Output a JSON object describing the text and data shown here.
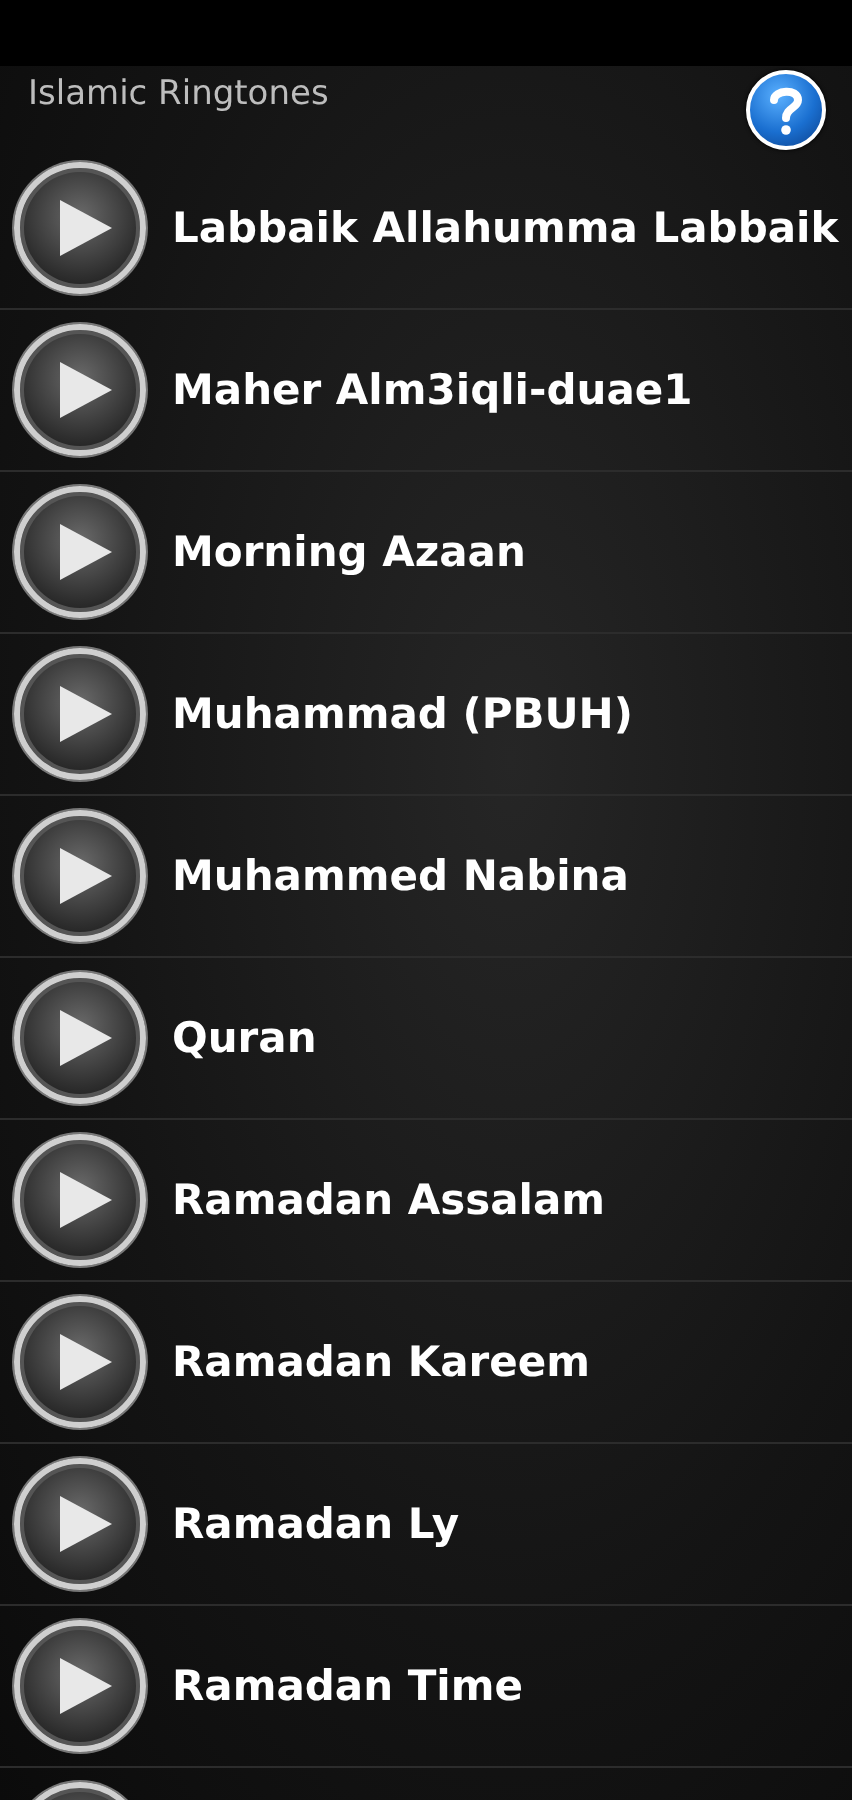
{
  "header": {
    "title": "Islamic Ringtones"
  },
  "ringtones": [
    {
      "title": "Labbaik Allahumma Labbaik"
    },
    {
      "title": "Maher Alm3iqli-duae1"
    },
    {
      "title": "Morning Azaan"
    },
    {
      "title": "Muhammad (PBUH)"
    },
    {
      "title": "Muhammed Nabina"
    },
    {
      "title": "Quran"
    },
    {
      "title": "Ramadan Assalam"
    },
    {
      "title": "Ramadan Kareem"
    },
    {
      "title": "Ramadan Ly"
    },
    {
      "title": "Ramadan Time"
    }
  ]
}
